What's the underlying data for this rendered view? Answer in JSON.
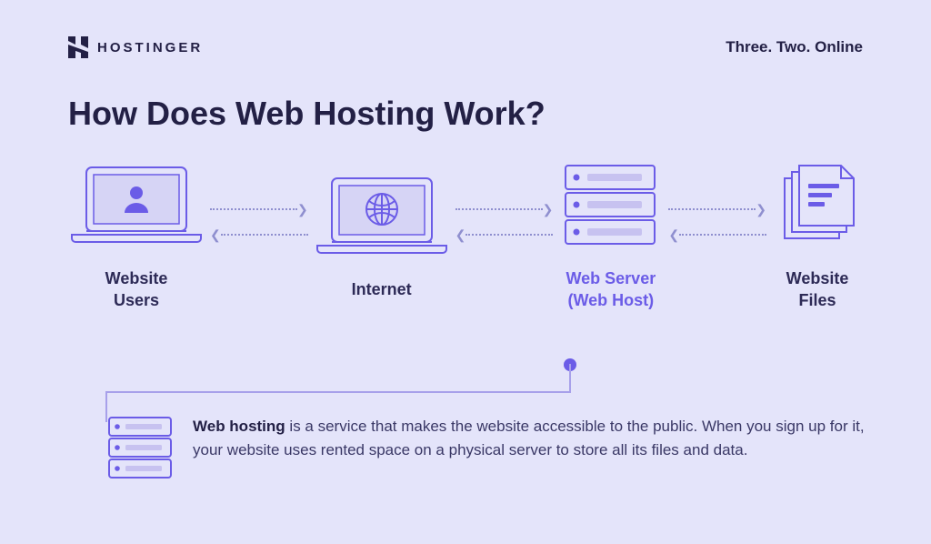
{
  "header": {
    "brand": "HOSTINGER",
    "tagline": "Three. Two. Online"
  },
  "title": "How Does Web Hosting Work?",
  "flow": {
    "items": [
      {
        "label": "Website\nUsers"
      },
      {
        "label": "Internet"
      },
      {
        "label": "Web Server\n(Web Host)"
      },
      {
        "label": "Website\nFiles"
      }
    ]
  },
  "callout": {
    "strong": "Web hosting",
    "body_rest": " is a service that makes the website accessible to the public. When you sign up for it, your website uses rented space on a physical server to store all its files and data."
  }
}
